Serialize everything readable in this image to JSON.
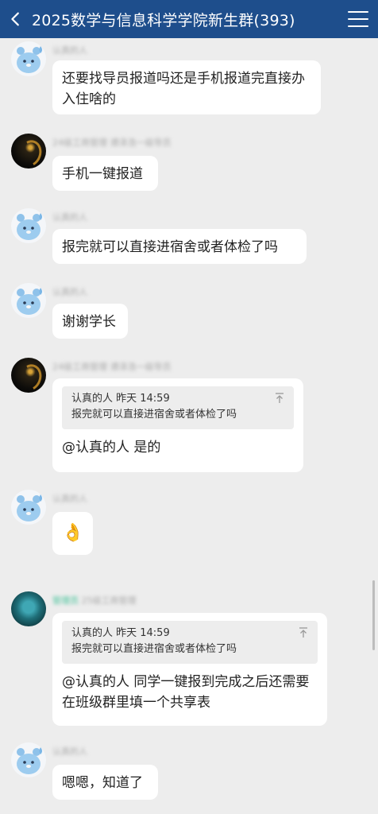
{
  "header": {
    "title": "2025数学与信息科学学院新生群(393)"
  },
  "messages": [
    {
      "sender": "认真的人",
      "text": "还要找导员报道吗还是手机报道完直接办入住啥的"
    },
    {
      "sender": "24级工商管理 谭泽浩一级导员",
      "text": "手机一键报道"
    },
    {
      "sender": "认真的人",
      "text": "报完就可以直接进宿舍或者体检了吗"
    },
    {
      "sender": "认真的人",
      "text": "谢谢学长"
    },
    {
      "sender": "24级工商管理 谭泽浩一级导员",
      "quote": {
        "meta": "认真的人 昨天 14:59",
        "text": "报完就可以直接进宿舍或者体检了吗"
      },
      "text": "@认真的人 是的"
    },
    {
      "sender": "认真的人",
      "text": "👌"
    },
    {
      "sender_tag": "管理员",
      "sender": "25级工商管理",
      "quote": {
        "meta": "认真的人 昨天 14:59",
        "text": "报完就可以直接进宿舍或者体检了吗"
      },
      "text": "@认真的人 同学一键报到完成之后还需要在班级群里填一个共享表"
    },
    {
      "sender": "认真的人",
      "text": "嗯嗯，知道了"
    }
  ]
}
